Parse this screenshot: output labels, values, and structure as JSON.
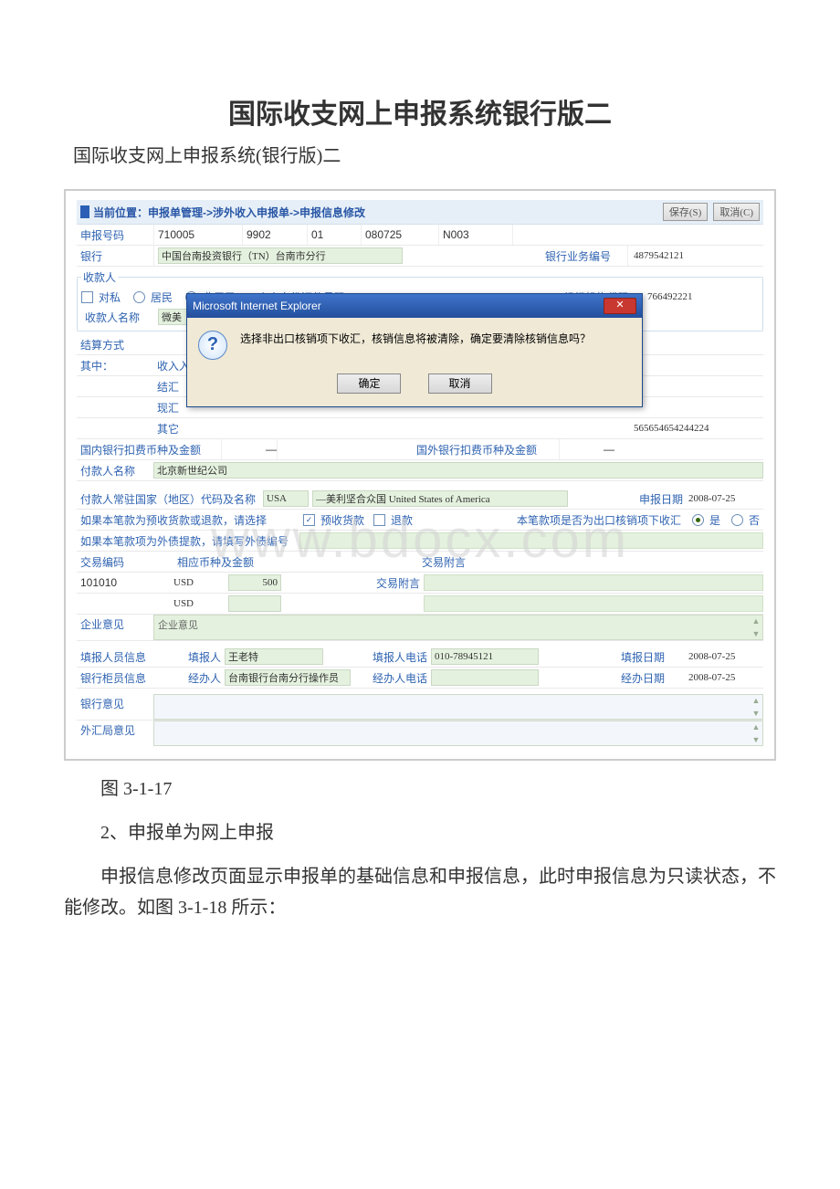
{
  "doc": {
    "title": "国际收支网上申报系统银行版二",
    "subtitle": "国际收支网上申报系统(银行版)二",
    "caption": "图 3-1-17",
    "point2": "2、申报单为网上申报",
    "para": "申报信息修改页面显示申报单的基础信息和申报信息，此时申报信息为只读状态，不能修改。如图 3-1-18 所示："
  },
  "watermark": "www.bdocx.com",
  "breadcrumb": "当前位置：申报单管理->涉外收入申报单->申报信息修改",
  "buttons": {
    "save": "保存(S)",
    "cancel": "取消(C)"
  },
  "declNo": {
    "label": "申报号码",
    "p1": "710005",
    "p2": "9902",
    "p3": "01",
    "p4": "080725",
    "p5": "N003"
  },
  "bank": {
    "label": "银行",
    "value": "中国台南投资银行（TN）台南市分行",
    "bizNoLabel": "银行业务编号",
    "bizNo": "4879542121"
  },
  "payee": {
    "legend": "收款人",
    "duisi": "对私",
    "juminLabel": "居民",
    "feijuminLabel": "非居民",
    "idLabel": "个人身份证件号码",
    "orgLabel": "组织机构代码",
    "orgCode": "766492221",
    "nameLabel": "收款人名称",
    "namePrefix": "微美"
  },
  "settle": {
    "label": "结算方式",
    "sub": "其中：",
    "r1": "收入入",
    "r2": "结汇",
    "r3": "现汇",
    "r4": "其它",
    "otherVal": "565654654244224",
    "domLabel": "国内银行扣费币种及金额",
    "forLabel": "国外银行扣费币种及金额"
  },
  "payer": {
    "label": "付款人名称",
    "value": "北京新世纪公司"
  },
  "ctry": {
    "label": "付款人常驻国家（地区）代码及名称",
    "code": "USA",
    "desc": "—美利坚合众国 United States of America",
    "dateLabel": "申报日期",
    "date": "2008-07-25"
  },
  "adv": {
    "label": "如果本笔款为预收货款或退款，请选择",
    "cb1": "预收货款",
    "cb2": "退款",
    "exportLabel": "本笔款项是否为出口核销项下收汇",
    "yes": "是",
    "no": "否"
  },
  "extDebt": {
    "label": "如果本笔款项为外债提款，请填写外债编号"
  },
  "tx": {
    "codeLabel": "交易编码",
    "ccyLabel": "相应币种及金额",
    "noteLabel": "交易附言",
    "noteLabel2": "交易附言",
    "code": "101010",
    "ccy": "USD",
    "amt": "500",
    "ccy2": "USD"
  },
  "opinion": {
    "label": "企业意见",
    "placeholder": "企业意见"
  },
  "filler": {
    "rowLabel": "填报人员信息",
    "personLabel": "填报人",
    "person": "王老特",
    "phoneLabel": "填报人电话",
    "phone": "010-78945121",
    "dateLabel": "填报日期",
    "date": "2008-07-25"
  },
  "teller": {
    "rowLabel": "银行柜员信息",
    "personLabel": "经办人",
    "person": "台南银行台南分行操作员",
    "phoneLabel": "经办人电话",
    "dateLabel": "经办日期",
    "date": "2008-07-25"
  },
  "bankOp": {
    "label": "银行意见"
  },
  "safeOp": {
    "label": "外汇局意见"
  },
  "dialog": {
    "title": "Microsoft Internet Explorer",
    "msg": "选择非出口核销项下收汇，核销信息将被清除，确定要清除核销信息吗？",
    "ok": "确定",
    "cancel": "取消"
  }
}
